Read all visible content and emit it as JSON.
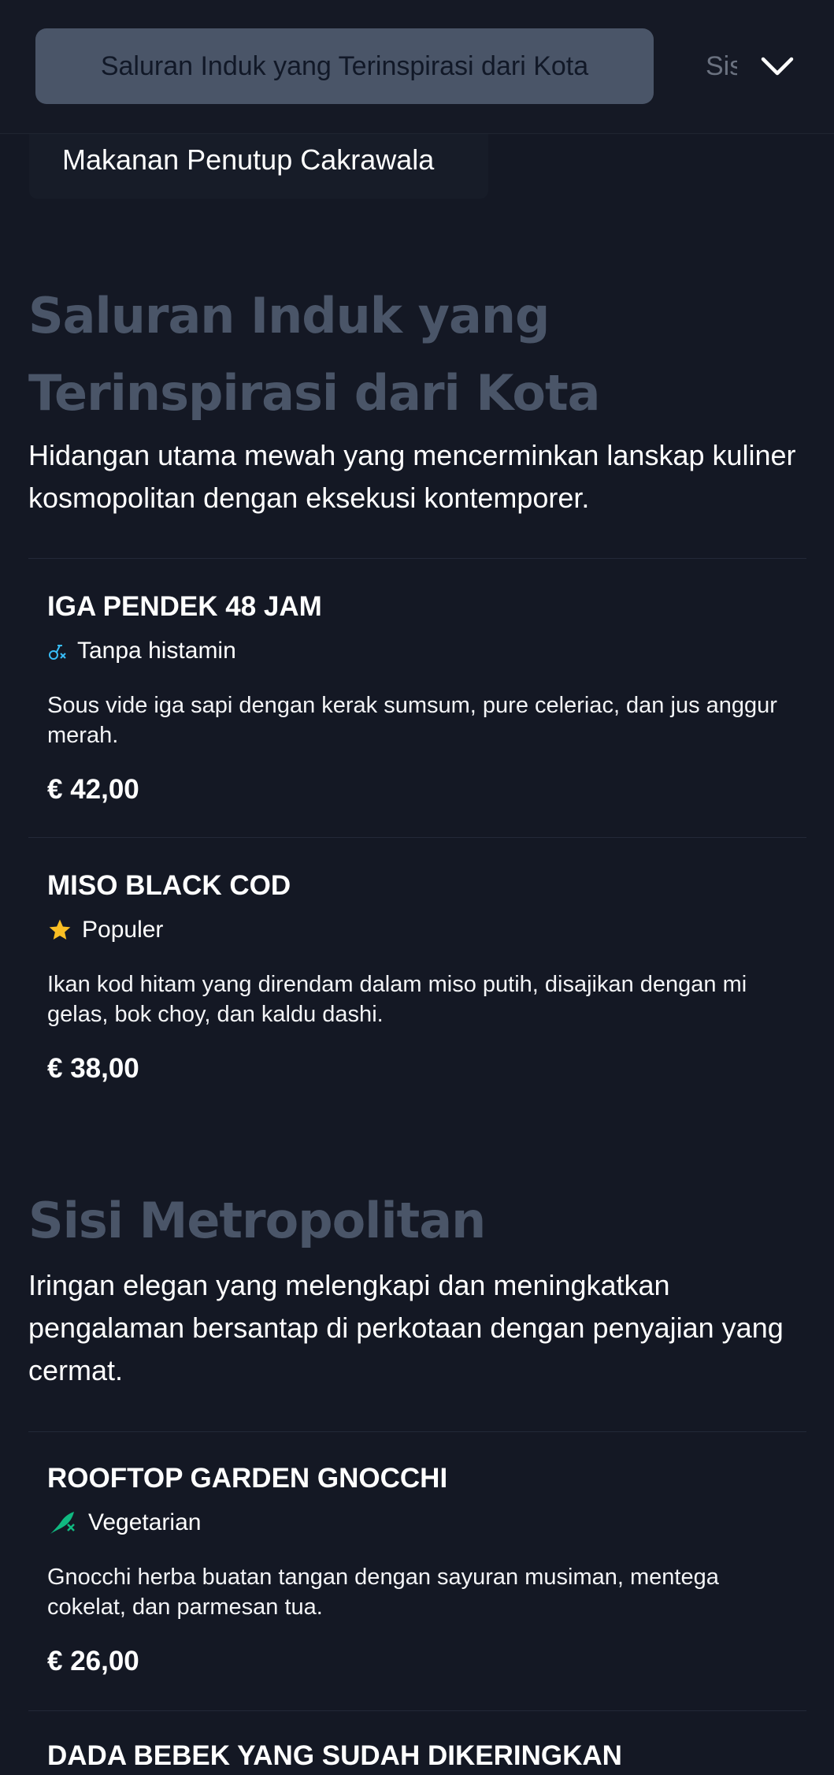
{
  "nav": {
    "active_tab": "Saluran Induk yang Terinspirasi dari Kota",
    "next_tab": "Sisi Metropolitan",
    "prev_section": "Makanan Penutup Cakrawala",
    "expand_icon": "chevron-down-icon"
  },
  "sections": [
    {
      "title": "Saluran Induk yang Terinspirasi dari Kota",
      "description": "Hidangan utama mewah yang mencerminkan lanskap kuliner kosmopolitan dengan eksekusi kontemporer.",
      "items": [
        {
          "name": "IGA PENDEK 48 JAM",
          "tag": "Tanpa histamin",
          "tag_icon": "histamine-free-icon",
          "tag_color": "#38bdf8",
          "description": "Sous vide iga sapi dengan kerak sumsum, pure celeriac, dan jus anggur merah.",
          "price": "€ 42,00"
        },
        {
          "name": "MISO BLACK COD",
          "tag": "Populer",
          "tag_icon": "star-icon",
          "tag_color": "#fbbf24",
          "description": "Ikan kod hitam yang direndam dalam miso putih, disajikan dengan mi gelas, bok choy, dan kaldu dashi.",
          "price": "€ 38,00"
        }
      ]
    },
    {
      "title": "Sisi Metropolitan",
      "description": "Iringan elegan yang melengkapi dan meningkatkan pengalaman bersantap di perkotaan dengan penyajian yang cermat.",
      "items": [
        {
          "name": "ROOFTOP GARDEN GNOCCHI",
          "tag": "Vegetarian",
          "tag_icon": "vegetarian-icon",
          "tag_color": "#10b981",
          "description": "Gnocchi herba buatan tangan dengan sayuran musiman, mentega cokelat, dan parmesan tua.",
          "price": "€ 26,00"
        },
        {
          "name": "DADA BEBEK YANG SUDAH DIKERINGKAN"
        }
      ]
    }
  ],
  "colors": {
    "background": "#141824",
    "section_title": "#4a5568",
    "tab_active_bg": "#4a5568"
  }
}
